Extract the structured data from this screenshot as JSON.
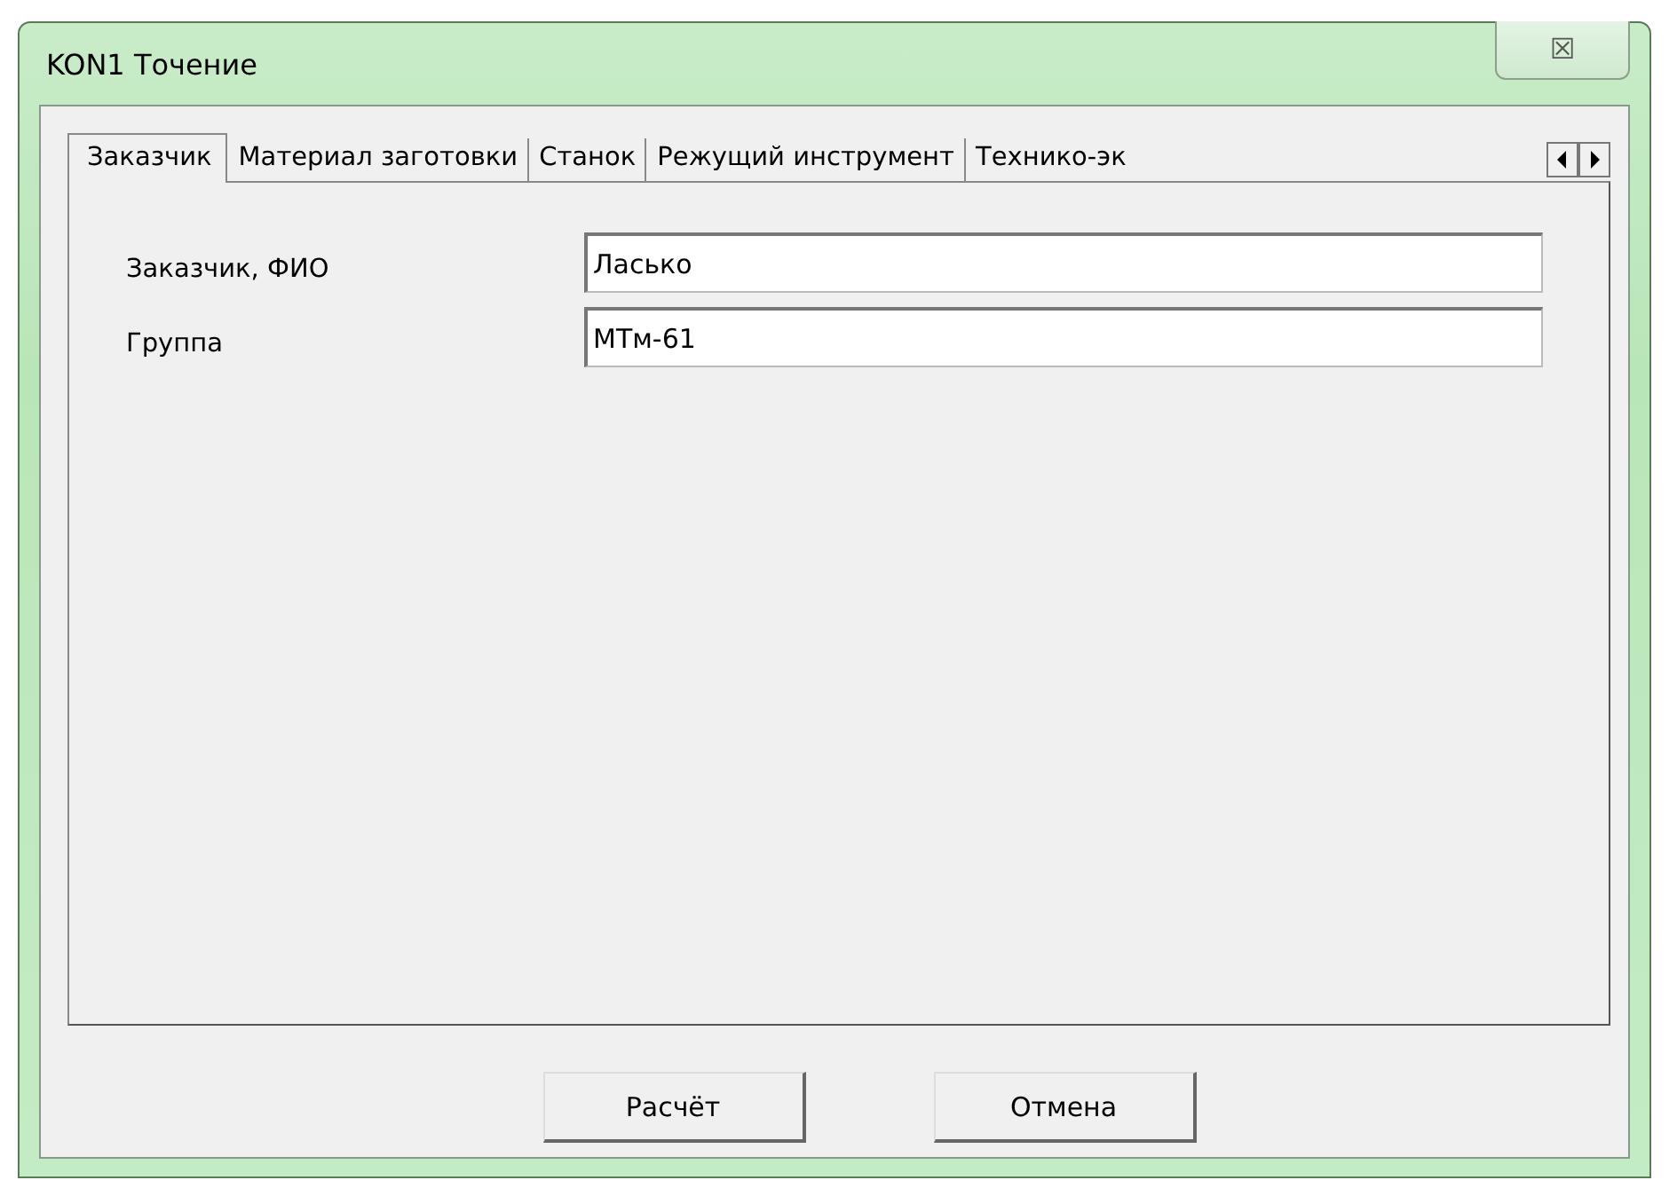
{
  "window": {
    "title": "KON1 Точение",
    "close_icon": "☒"
  },
  "tabs": [
    {
      "label": "Заказчик",
      "selected": true
    },
    {
      "label": "Материал заготовки",
      "selected": false
    },
    {
      "label": "Станок",
      "selected": false
    },
    {
      "label": "Режущий инструмент",
      "selected": false
    },
    {
      "label": "Технико-эк",
      "selected": false
    }
  ],
  "fields": [
    {
      "label": "Заказчик, ФИО",
      "value": "Ласько"
    },
    {
      "label": "Группа",
      "value": "МТм-61"
    }
  ],
  "buttons": [
    "Расчёт",
    "Отмена"
  ]
}
